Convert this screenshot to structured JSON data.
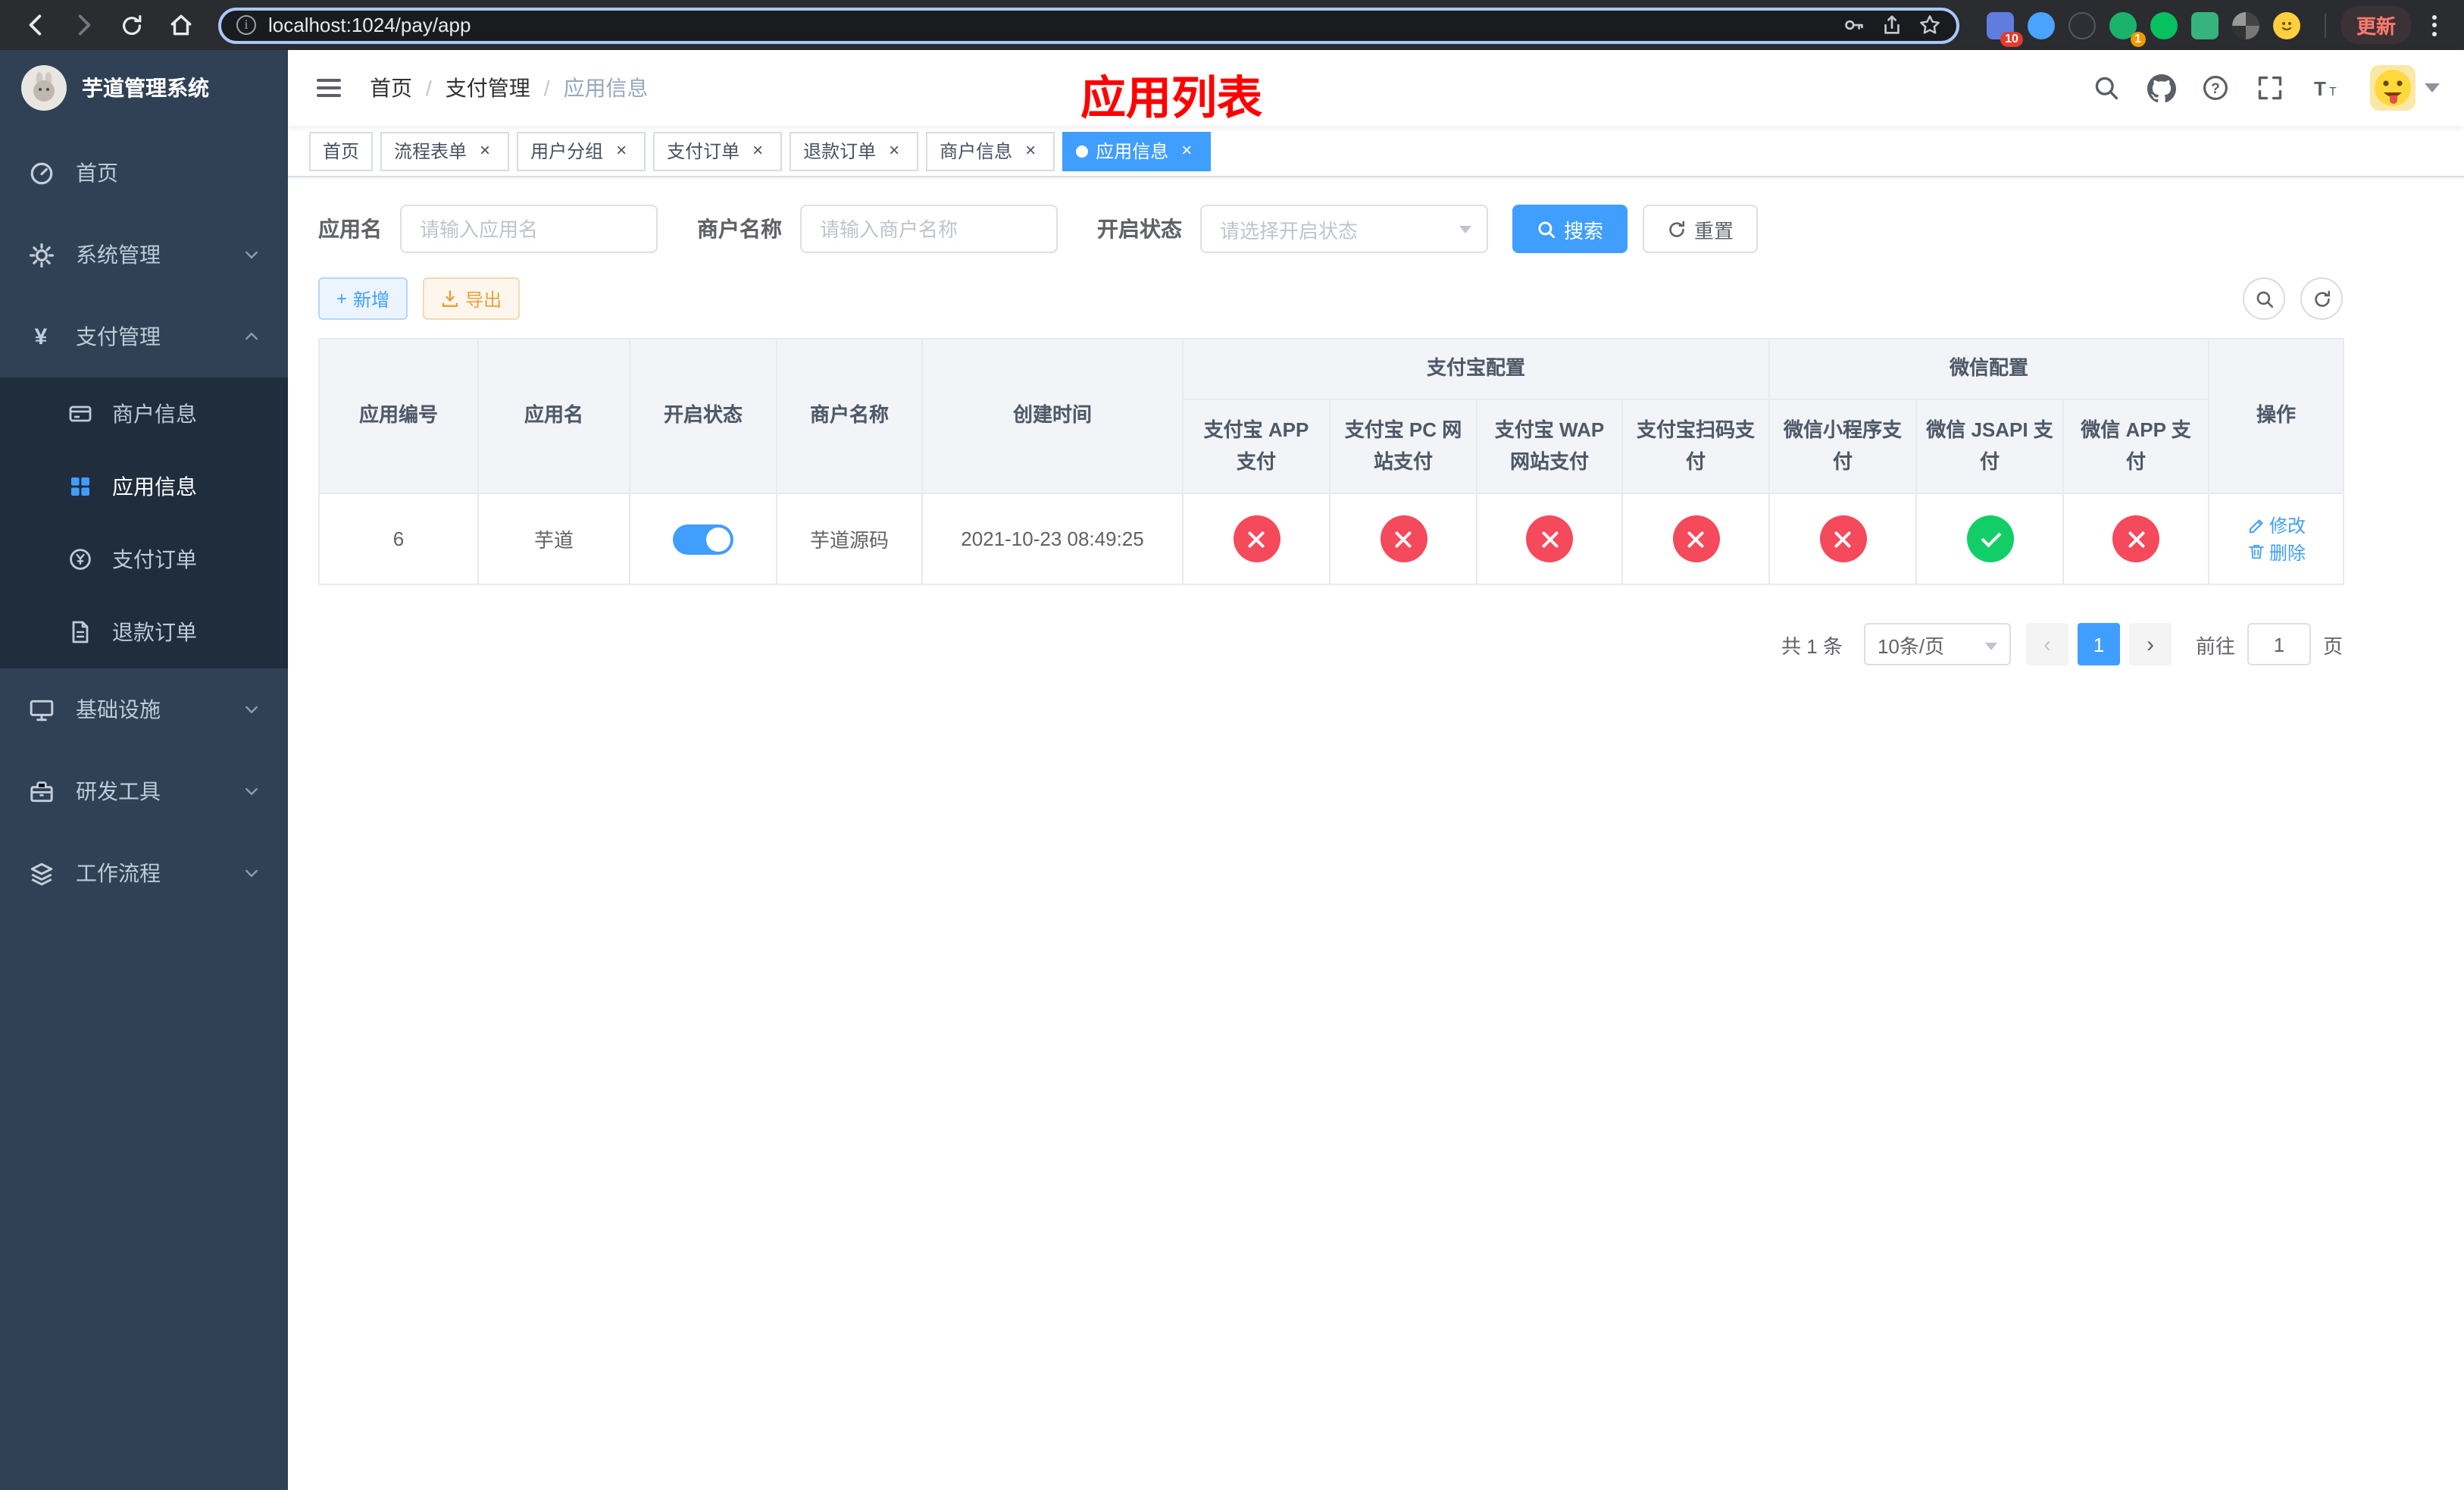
{
  "theme": {
    "accent": "#409eff",
    "danger": "#f5495c",
    "success": "#13ce66",
    "sidebar-bg": "#304156",
    "submenu-bg": "#1f2d3d",
    "overlay-red": "#ff0000"
  },
  "icons": {
    "close": "×",
    "prev": "‹",
    "next": "›",
    "yen": "¥",
    "plus": "+",
    "breadcrumb_sep": "/"
  },
  "browser": {
    "url": "localhost:1024/pay/app",
    "update_label": "更新",
    "extension_badge_primary": "10",
    "extension_badge_secondary": "1"
  },
  "sidebar": {
    "title": "芋道管理系统",
    "items": [
      {
        "label": "首页"
      },
      {
        "label": "系统管理"
      },
      {
        "label": "支付管理",
        "expanded": true,
        "children": [
          {
            "label": "商户信息"
          },
          {
            "label": "应用信息",
            "active": true
          },
          {
            "label": "支付订单"
          },
          {
            "label": "退款订单"
          }
        ]
      },
      {
        "label": "基础设施"
      },
      {
        "label": "研发工具"
      },
      {
        "label": "工作流程"
      }
    ]
  },
  "header": {
    "breadcrumb": [
      "首页",
      "支付管理",
      "应用信息"
    ],
    "overlay_title": "应用列表"
  },
  "tabs": [
    {
      "label": "首页",
      "closable": false,
      "active": false
    },
    {
      "label": "流程表单",
      "closable": true,
      "active": false
    },
    {
      "label": "用户分组",
      "closable": true,
      "active": false
    },
    {
      "label": "支付订单",
      "closable": true,
      "active": false
    },
    {
      "label": "退款订单",
      "closable": true,
      "active": false
    },
    {
      "label": "商户信息",
      "closable": true,
      "active": false
    },
    {
      "label": "应用信息",
      "closable": true,
      "active": true
    }
  ],
  "filters": {
    "app_name_label": "应用名",
    "app_name_placeholder": "请输入应用名",
    "merchant_label": "商户名称",
    "merchant_placeholder": "请输入商户名称",
    "status_label": "开启状态",
    "status_placeholder": "请选择开启状态",
    "search_label": "搜索",
    "reset_label": "重置"
  },
  "toolbar": {
    "add_label": "新增",
    "export_label": "导出"
  },
  "table": {
    "col_app_id": "应用编号",
    "col_app_name": "应用名",
    "col_status": "开启状态",
    "col_merchant": "商户名称",
    "col_created": "创建时间",
    "group_alipay": "支付宝配置",
    "group_wechat": "微信配置",
    "col_alipay_app": "支付宝 APP 支付",
    "col_alipay_pc": "支付宝 PC 网站支付",
    "col_alipay_wap": "支付宝 WAP 网站支付",
    "col_alipay_qr": "支付宝扫码支付",
    "col_wx_mini": "微信小程序支付",
    "col_wx_jsapi": "微信 JSAPI 支付",
    "col_wx_app": "微信 APP 支付",
    "col_actions": "操作",
    "actions": {
      "edit": "修改",
      "delete": "删除"
    },
    "rows": [
      {
        "id": "6",
        "name": "芋道",
        "enabled": true,
        "merchant": "芋道源码",
        "created_at": "2021-10-23 08:49:25",
        "configs": {
          "alipay_app": false,
          "alipay_pc": false,
          "alipay_wap": false,
          "alipay_qr": false,
          "wx_mini": false,
          "wx_jsapi": true,
          "wx_app": false
        }
      }
    ]
  },
  "pagination": {
    "total": "共 1 条",
    "page_size": "10条/页",
    "page": "1",
    "goto_label": "前往",
    "goto_value": "1",
    "unit_label": "页"
  }
}
